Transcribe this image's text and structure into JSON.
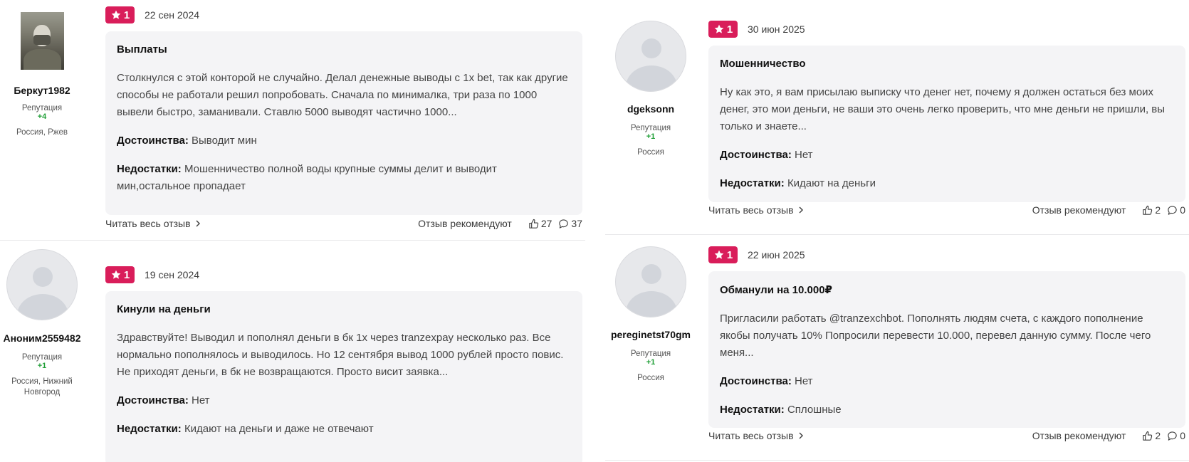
{
  "ui": {
    "rep_label": "Репутация",
    "props_label": "Достоинства:",
    "cons_label": "Недостатки:",
    "read_more": "Читать весь отзыв",
    "recommend": "Отзыв рекомендуют"
  },
  "colors": {
    "badge": "#d91d5a",
    "reputation": "#21a038",
    "bubble": "#f4f4f6"
  },
  "reviews": [
    {
      "author": "Беркут1982",
      "avatar": "user-photo",
      "reputation": "+4",
      "location": "Россия, Ржев",
      "rating": "1",
      "date": "22 сен 2024",
      "title": "Выплаты",
      "text": "Столкнулся с этой конторой не случайно. Делал денежные выводы с 1х bet, так как другие способы не работали решил попробовать. Сначала по минималка, три раза по 1000 вывели быстро, заманивали. Ставлю 5000 выводят частично 1000...",
      "pros": "Выводит мин",
      "cons": "Мошенничество полной воды крупные суммы делит и выводит мин,остальное пропадает",
      "likes": "27",
      "comments": "37"
    },
    {
      "author": "Аноним2559482",
      "avatar": "default-avatar",
      "reputation": "+1",
      "location": "Россия, Нижний Новгород",
      "rating": "1",
      "date": "19 сен 2024",
      "title": "Кинули на деньги",
      "text": "Здравствуйте! Выводил и пополнял деньги в бк 1х через tranzexpay несколько раз. Все нормально пополнялось и выводилось. Но 12 сентября вывод 1000 рублей просто повис. Не приходят деньги, в бк не возвращаются. Просто висит заявка...",
      "pros": "Нет",
      "cons": "Кидают на деньги и даже не отвечают"
    },
    {
      "author": "dgeksonn",
      "avatar": "default-avatar",
      "reputation": "+1",
      "location": "Россия",
      "rating": "1",
      "date": "30 июн 2025",
      "title": "Мошенничество",
      "text": "Ну как это, я вам присылаю выписку что денег нет, почему я должен остаться без моих денег, это мои деньги, не ваши это очень легко проверить, что мне деньги не пришли, вы только и знаете...",
      "pros": "Нет",
      "cons": "Кидают на деньги",
      "likes": "2",
      "comments": "0"
    },
    {
      "author": "pereginetst70gm",
      "avatar": "default-avatar",
      "reputation": "+1",
      "location": "Россия",
      "rating": "1",
      "date": "22 июн 2025",
      "title": "Обманули на 10.000₽",
      "text": "Пригласили работать @tranzexchbot. Пополнять людям счета, с каждого пополнение якобы получать 10% Попросили перевести 10.000, перевел данную сумму. После чего меня...",
      "pros": "Нет",
      "cons": "Сплошные",
      "likes": "2",
      "comments": "0"
    }
  ]
}
